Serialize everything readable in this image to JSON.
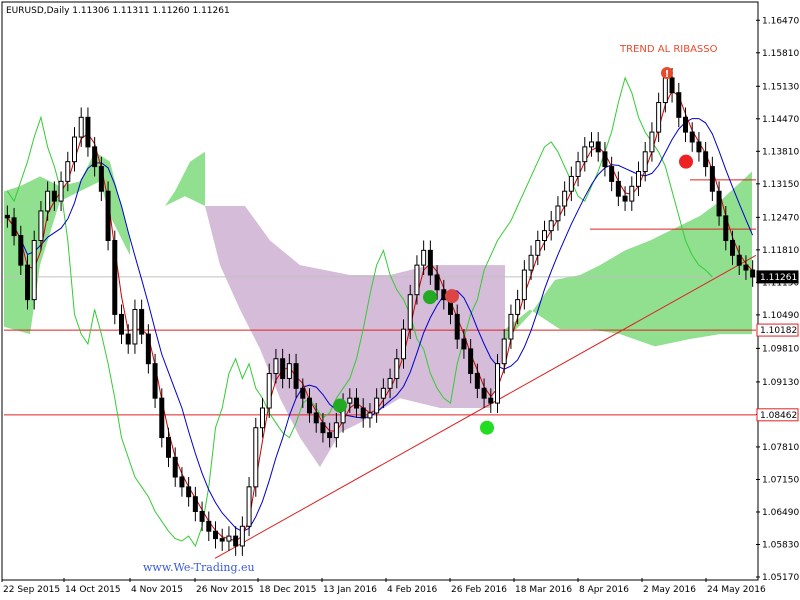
{
  "chart_data": {
    "type": "line",
    "title": "EURUSD,Daily  1.11306 1.11311 1.11260 1.11261",
    "ylim": [
      1.0515,
      1.168
    ],
    "y_ticks": [
      "1.16470",
      "1.15810",
      "1.15130",
      "1.14470",
      "1.13810",
      "1.13150",
      "1.12470",
      "1.11810",
      "1.11150",
      "1.10490",
      "1.09810",
      "1.09130",
      "1.08470",
      "1.07810",
      "1.07150",
      "1.06490",
      "1.05830",
      "1.05170"
    ],
    "x_ticks": [
      "22 Sep 2015",
      "14 Oct 2015",
      "4 Nov 2015",
      "26 Nov 2015",
      "18 Dec 2015",
      "13 Jan 2016",
      "4 Feb 2016",
      "26 Feb 2016",
      "18 Mar 2016",
      "8 Apr 2016",
      "2 May 2016",
      "24 May 2016"
    ],
    "price_labels": [
      {
        "text": "1.11261",
        "value": 1.11261,
        "style": "current"
      },
      {
        "text": "1.10182",
        "value": 1.10182,
        "style": "red"
      },
      {
        "text": "1.08462",
        "value": 1.08462,
        "style": "red"
      }
    ],
    "horizontal_levels": [
      1.10182,
      1.08462,
      1.1323,
      1.1223
    ],
    "close_series": [
      1.1246,
      1.121,
      1.115,
      1.108,
      1.12,
      1.126,
      1.13,
      1.128,
      1.132,
      1.136,
      1.141,
      1.145,
      1.139,
      1.135,
      1.13,
      1.12,
      1.105,
      1.101,
      1.099,
      1.106,
      1.101,
      1.095,
      1.088,
      1.08,
      1.076,
      1.072,
      1.07,
      1.068,
      1.065,
      1.063,
      1.061,
      1.0595,
      1.059,
      1.06,
      1.058,
      1.062,
      1.07,
      1.082,
      1.086,
      1.093,
      1.096,
      1.092,
      1.095,
      1.09,
      1.088,
      1.085,
      1.083,
      1.081,
      1.08,
      1.083,
      1.087,
      1.088,
      1.086,
      1.084,
      1.085,
      1.088,
      1.09,
      1.092,
      1.096,
      1.102,
      1.109,
      1.115,
      1.118,
      1.113,
      1.11,
      1.108,
      1.105,
      1.1,
      1.098,
      1.093,
      1.09,
      1.088,
      1.087,
      1.095,
      1.1,
      1.105,
      1.108,
      1.114,
      1.117,
      1.12,
      1.122,
      1.124,
      1.127,
      1.13,
      1.133,
      1.136,
      1.139,
      1.14,
      1.138,
      1.135,
      1.132,
      1.129,
      1.128,
      1.131,
      1.134,
      1.138,
      1.142,
      1.148,
      1.153,
      1.15,
      1.145,
      1.142,
      1.14,
      1.138,
      1.135,
      1.13,
      1.125,
      1.12,
      1.117,
      1.115,
      1.114,
      1.1126
    ],
    "indicators": [
      {
        "name": "tenkan",
        "color": "#cc0000"
      },
      {
        "name": "kijun",
        "color": "#0000cc"
      },
      {
        "name": "chikou",
        "color": "#33cc33"
      },
      {
        "name": "kumo",
        "colors": [
          "#90e090",
          "#d5bcd8"
        ]
      },
      {
        "name": "trendline",
        "color": "#dd2222",
        "from": 1.0555,
        "to": 1.117
      }
    ],
    "signals": [
      {
        "color": "#ee2222",
        "value": 1.136
      },
      {
        "color": "#22aa22",
        "value": 1.1085
      },
      {
        "color": "#dd4444",
        "value": 1.1087
      },
      {
        "color": "#22aa22",
        "value": 1.0865
      },
      {
        "color": "#22dd22",
        "value": 1.082
      }
    ],
    "annotation": "TREND AL RIBASSO",
    "watermark": "www.We-Trading.eu"
  }
}
